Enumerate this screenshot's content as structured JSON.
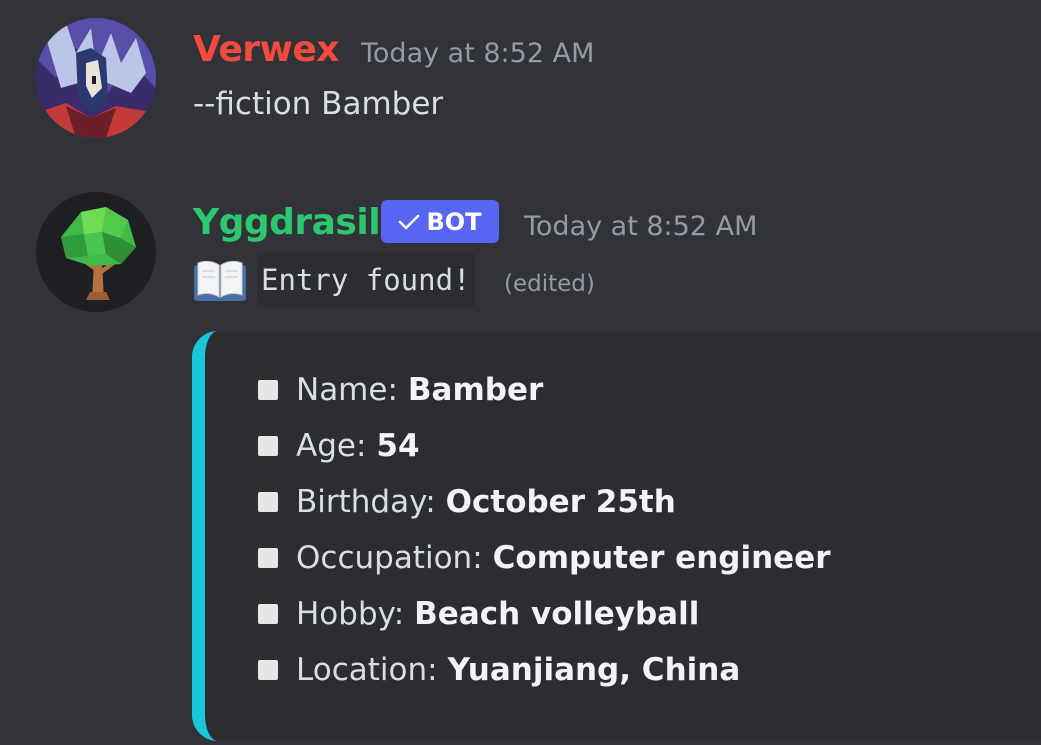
{
  "messages": [
    {
      "author": "Verwex",
      "author_color": "#f04b3e",
      "timestamp": "Today at 8:52 AM",
      "content": "--fiction Bamber",
      "avatar_icon": "pixel-art-character-avatar"
    },
    {
      "author": "Yggdrasil",
      "author_color": "#2dc770",
      "bot_badge": "BOT",
      "timestamp": "Today at 8:52 AM",
      "emoji": "open-book-emoji",
      "code_text": "Entry found!",
      "edited_label": "(edited)",
      "avatar_icon": "tree-avatar",
      "embed": {
        "accent_color": "#1ac7d8",
        "fields": [
          {
            "label": "Name:",
            "value": "Bamber"
          },
          {
            "label": "Age:",
            "value": "54"
          },
          {
            "label": "Birthday:",
            "value": "October 25th"
          },
          {
            "label": "Occupation:",
            "value": "Computer engineer"
          },
          {
            "label": "Hobby:",
            "value": "Beach volleyball"
          },
          {
            "label": "Location:",
            "value": "Yuanjiang, China"
          }
        ]
      }
    }
  ]
}
